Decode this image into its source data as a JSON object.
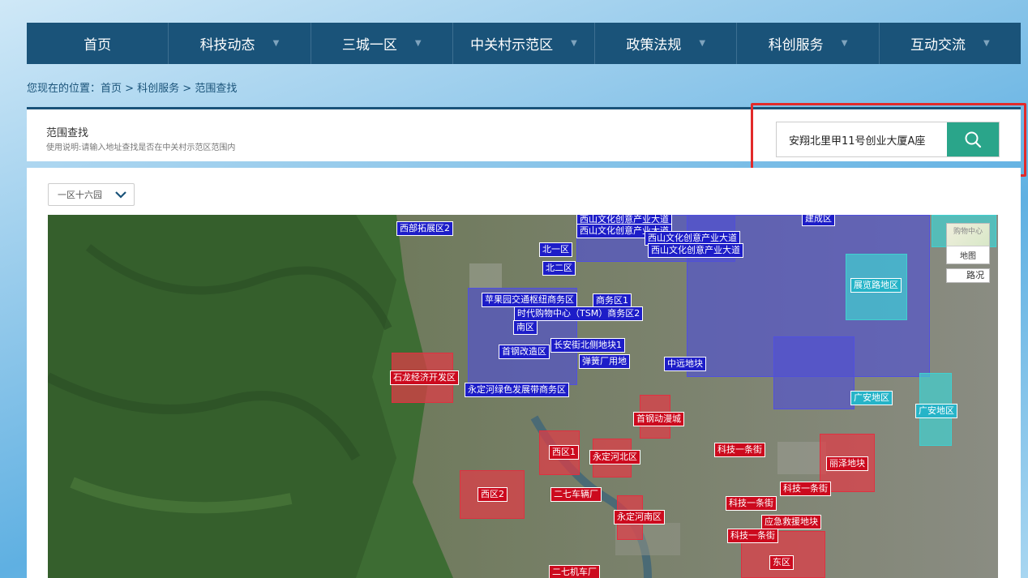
{
  "nav": {
    "items": [
      {
        "label": "首页",
        "has_dropdown": false
      },
      {
        "label": "科技动态",
        "has_dropdown": true
      },
      {
        "label": "三城一区",
        "has_dropdown": true
      },
      {
        "label": "中关村示范区",
        "has_dropdown": true
      },
      {
        "label": "政策法规",
        "has_dropdown": true
      },
      {
        "label": "科创服务",
        "has_dropdown": true
      },
      {
        "label": "互动交流",
        "has_dropdown": true
      }
    ]
  },
  "breadcrumb": "您现在的位置：首页 > 科创服务 > 范围查找",
  "search_panel": {
    "title": "范围查找",
    "description": "使用说明:请输入地址查找是否在中关村示范区范围内",
    "input_value": "安翔北里甲11号创业大厦A座",
    "button_icon": "search-icon"
  },
  "district_select": {
    "selected": "一区十六园",
    "icon": "chevron-down-icon"
  },
  "map": {
    "type_control": {
      "thumb_label": "购物中心",
      "map_label": "地图",
      "road_label": "路况"
    },
    "labels": {
      "blue": [
        "西部拓展区2",
        "北一区",
        "北二区",
        "西山文化创意产业大道",
        "西山文化创意产业大道",
        "西山文化创意产业大道",
        "西山文化创意产业大道",
        "苹果园交通枢纽商务区",
        "商务区1",
        "时代购物中心（TSM）商务区2",
        "南区",
        "首钢改造区",
        "长安街北侧地块1",
        "弹簧厂用地",
        "中远地块",
        "永定河绿色发展带商务区",
        "建成区"
      ],
      "red": [
        "石龙经济开发区",
        "首钢动漫城",
        "西区1",
        "永定河北区",
        "西区2",
        "二七车辆厂",
        "永定河南区",
        "科技一条街",
        "科技一条街",
        "科技一条街",
        "丽泽地块",
        "应急救援地块",
        "科技一条街",
        "东区",
        "二七机车厂"
      ],
      "cyan": [
        "展览路地区",
        "广安地区",
        "广安地区"
      ]
    }
  }
}
